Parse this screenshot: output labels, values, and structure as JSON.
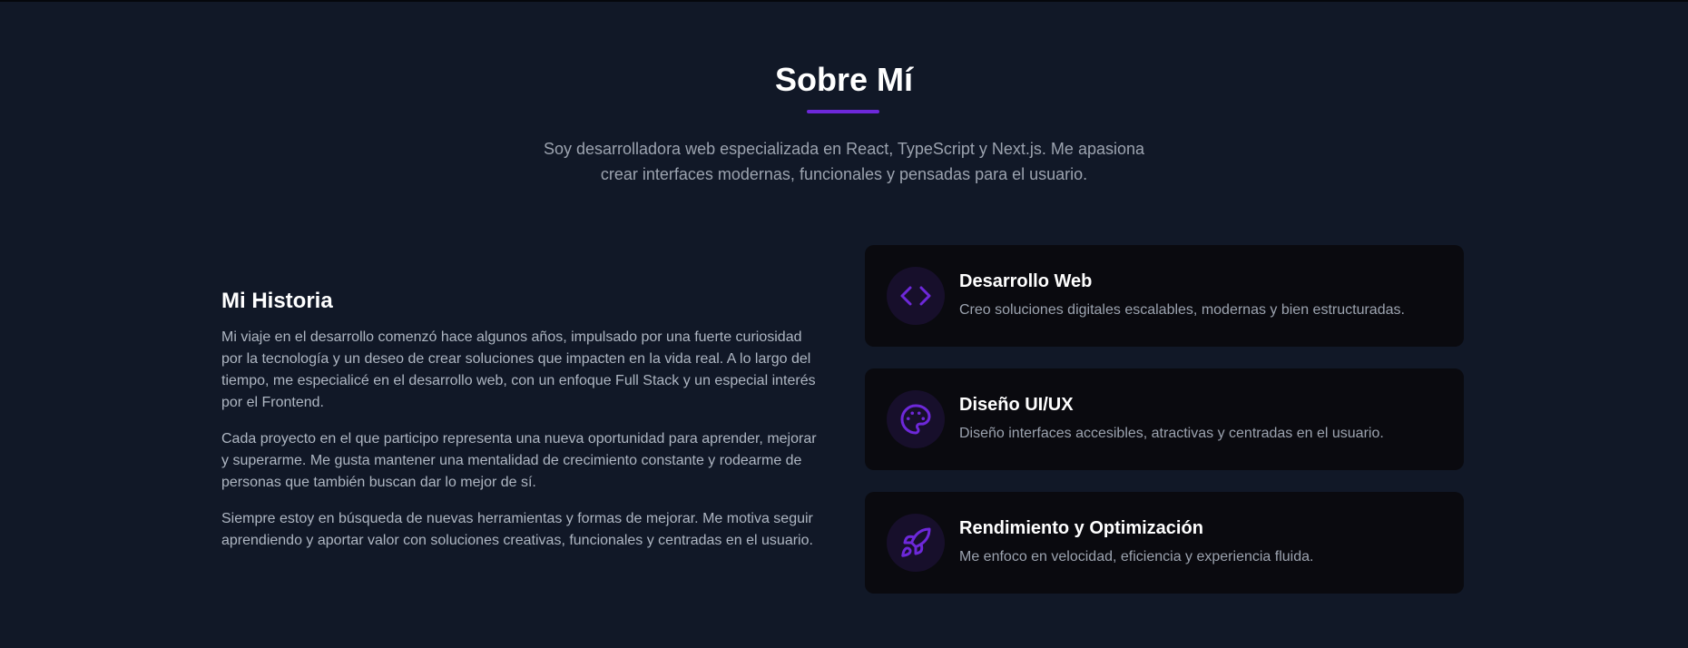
{
  "colors": {
    "background": "#111827",
    "card_background": "#0a0a0f",
    "accent": "#6d28d9",
    "muted_text": "#9ca3af"
  },
  "header": {
    "title": "Sobre Mí",
    "intro": "Soy desarrolladora web especializada en React, TypeScript y Next.js. Me apasiona crear interfaces modernas, funcionales y pensadas para el usuario."
  },
  "story": {
    "title": "Mi Historia",
    "paragraphs": [
      "Mi viaje en el desarrollo comenzó hace algunos años, impulsado por una fuerte curiosidad por la tecnología y un deseo de crear soluciones que impacten en la vida real. A lo largo del tiempo, me especialicé en el desarrollo web, con un enfoque Full Stack y un especial interés por el Frontend.",
      "Cada proyecto en el que participo representa una nueva oportunidad para aprender, mejorar y superarme. Me gusta mantener una mentalidad de crecimiento constante y rodearme de personas que también buscan dar lo mejor de sí.",
      "Siempre estoy en búsqueda de nuevas herramientas y formas de mejorar. Me motiva seguir aprendiendo y aportar valor con soluciones creativas, funcionales y centradas en el usuario."
    ]
  },
  "cards": [
    {
      "icon": "code-icon",
      "title": "Desarrollo Web",
      "description": "Creo soluciones digitales escalables, modernas y bien estructuradas."
    },
    {
      "icon": "palette-icon",
      "title": "Diseño UI/UX",
      "description": "Diseño interfaces accesibles, atractivas y centradas en el usuario."
    },
    {
      "icon": "rocket-icon",
      "title": "Rendimiento y Optimización",
      "description": "Me enfoco en velocidad, eficiencia y experiencia fluida."
    }
  ]
}
